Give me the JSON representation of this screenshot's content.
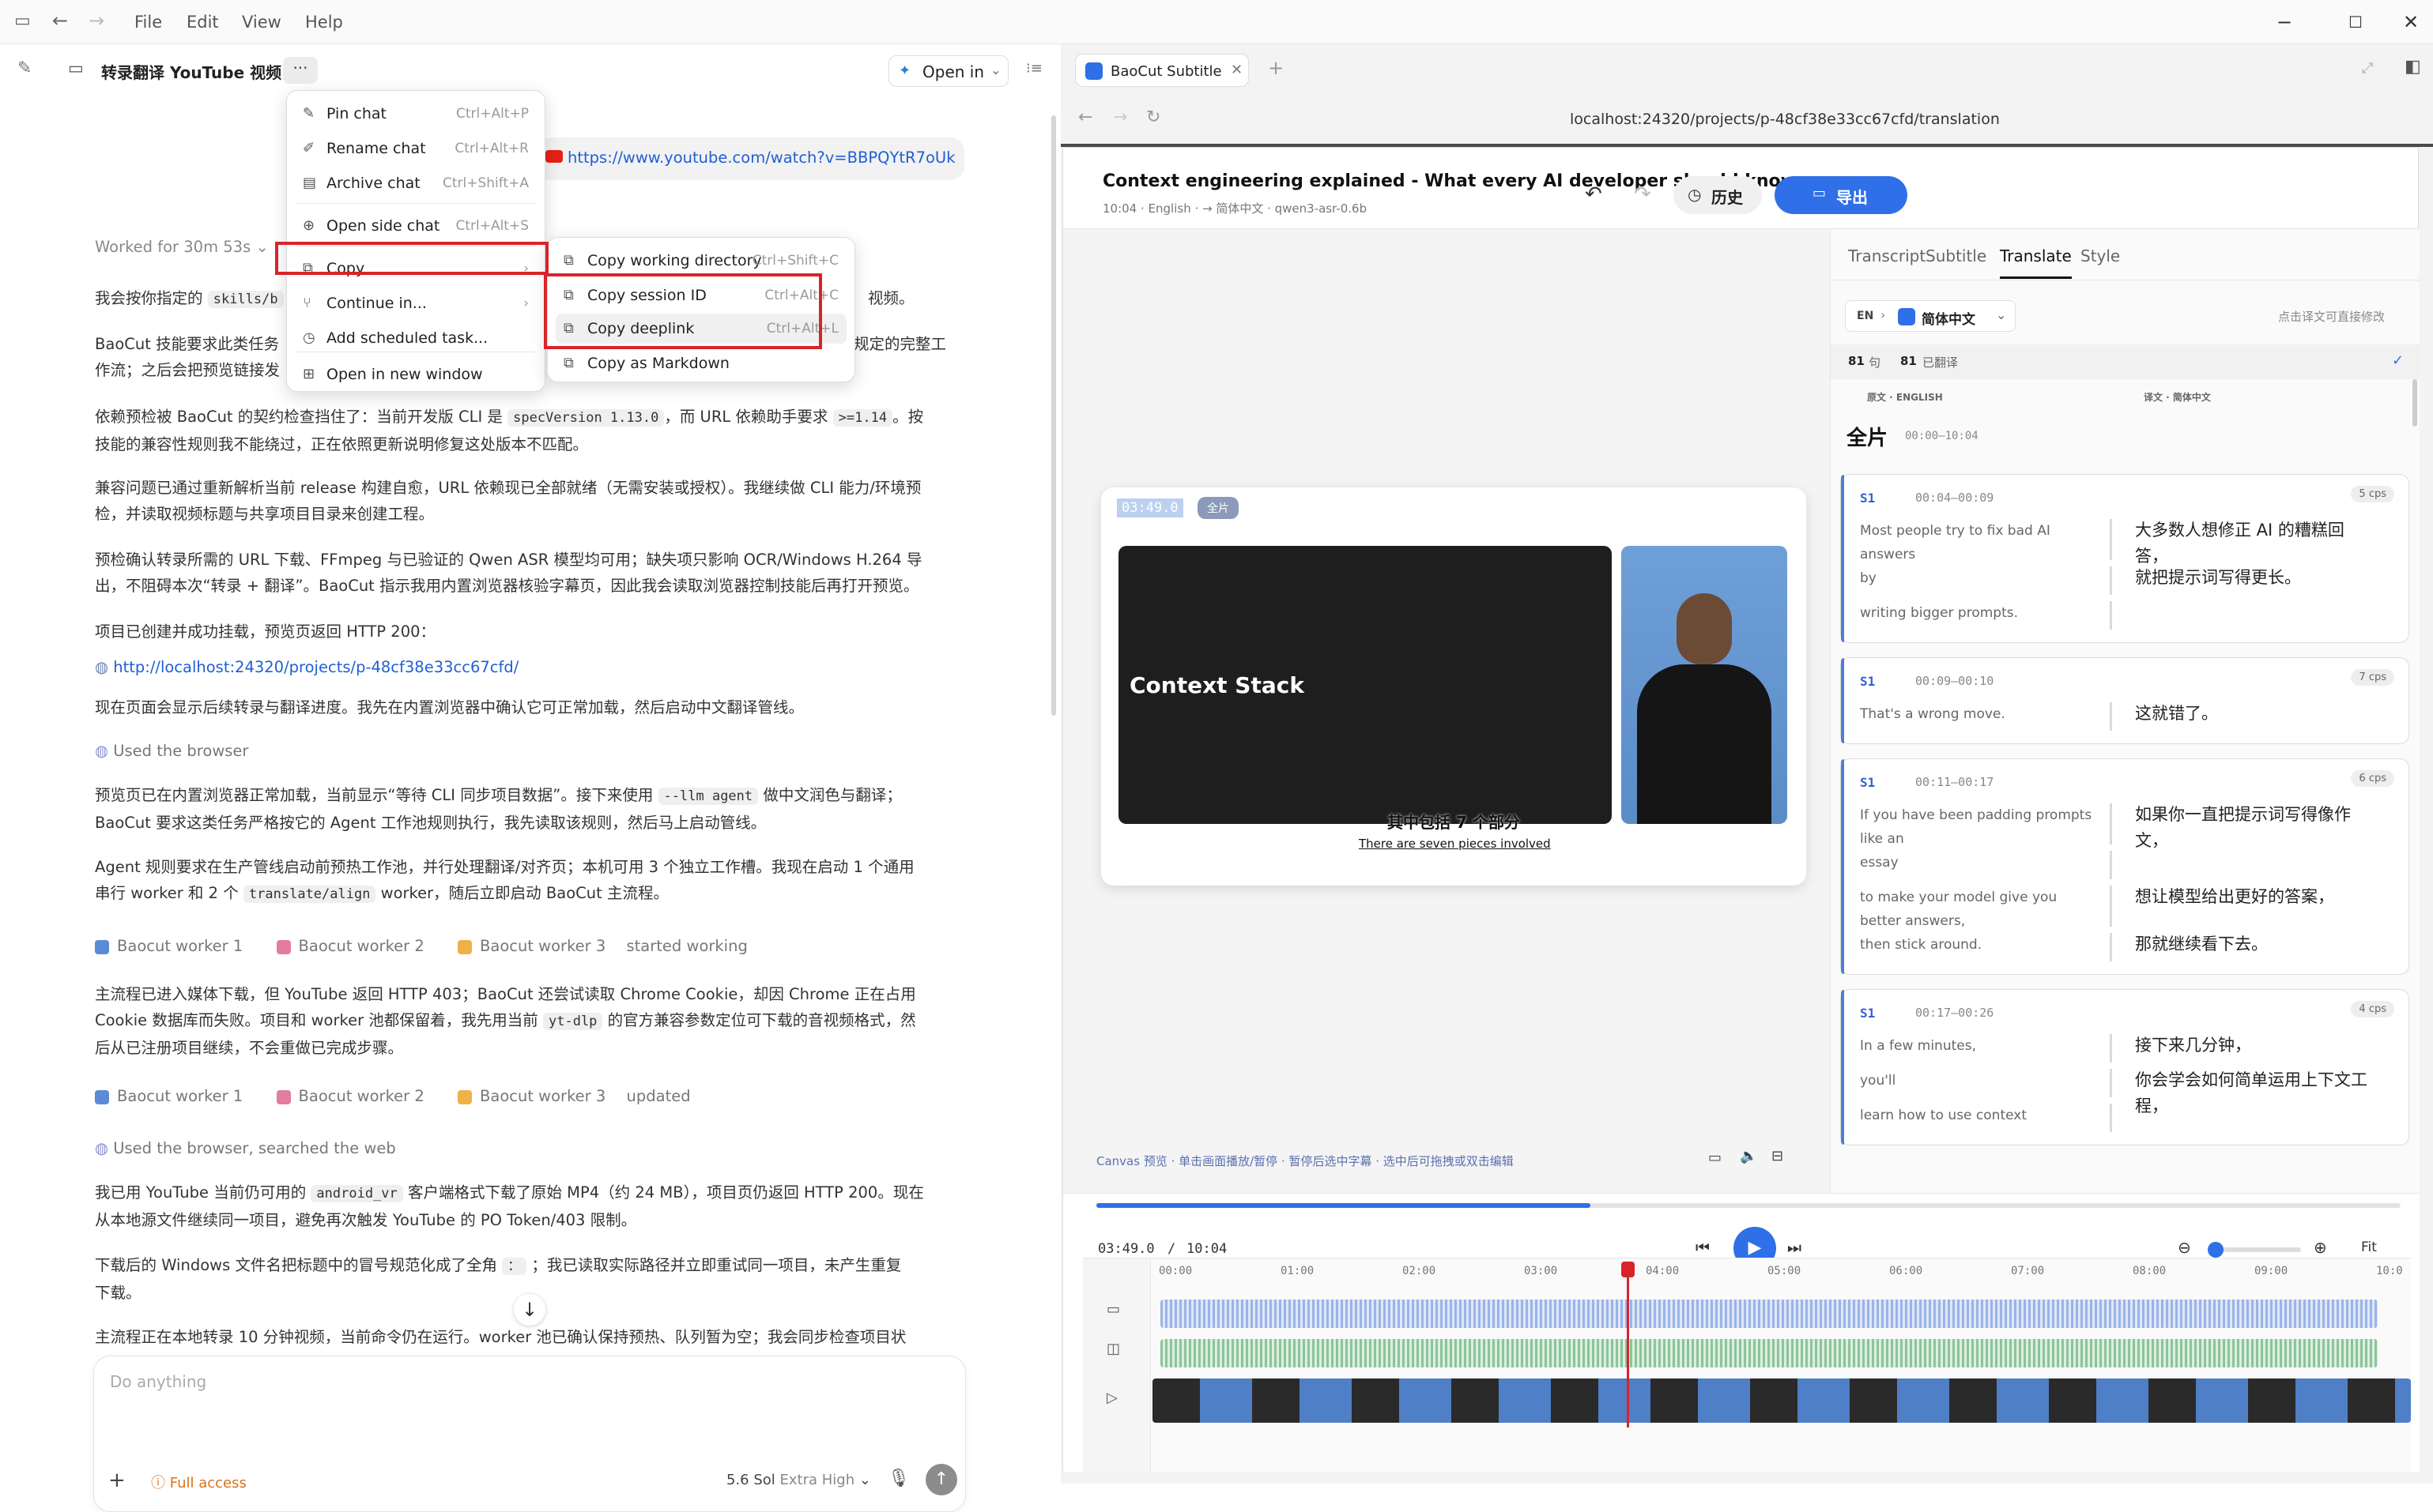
{
  "menubar": {
    "file": "File",
    "edit": "Edit",
    "view": "View",
    "help": "Help"
  },
  "chat": {
    "title": "转录翻译 YouTube 视频",
    "open_in": "Open in",
    "link": "https://www.youtube.com/watch?v=BBPQYtR7oUk",
    "worked": "Worked for 30m 53s",
    "p1a": "我会按你指定的",
    "p1code": "skills/b",
    "p1b": "视频。",
    "p2a": "BaoCut 技能要求此类任务",
    "p2b": "规定的完整工",
    "p2c": "作流；之后会把预览链接发",
    "p3a": "依赖预检被 BaoCut 的契约检查挡住了：当前开发版 CLI 是",
    "p3code1": "specVersion 1.13.0",
    "p3b": "，而 URL 依赖助手要求",
    "p3code2": ">=1.14",
    "p3c": "。按",
    "p3d": "技能的兼容性规则我不能绕过，正在依照更新说明修复这处版本不匹配。",
    "p4a": "兼容问题已通过重新解析当前 release 构建自愈，URL 依赖现已全部就绪（无需安装或授权）。我继续做 CLI 能力/环境预",
    "p4b": "检，并读取视频标题与共享项目目录来创建工程。",
    "p5a": "预检确认转录所需的 URL 下载、FFmpeg 与已验证的 Qwen ASR 模型均可用；缺失项只影响 OCR/Windows H.264 导",
    "p5b": "出，不阻碍本次“转录 + 翻译”。BaoCut 指示我用内置浏览器核验字幕页，因此我会读取浏览器控制技能后再打开预览。",
    "p6": "项目已创建并成功挂载，预览页返回 HTTP 200：",
    "p6link": "http://localhost:24320/projects/p-48cf38e33cc67cfd/",
    "p7": "现在页面会显示后续转录与翻译进度。我先在内置浏览器中确认它可正常加载，然后启动中文翻译管线。",
    "used1": "Used the browser",
    "p8a": "预览页已在内置浏览器正常加载，当前显示“等待 CLI 同步项目数据”。接下来使用",
    "p8code": "--llm agent",
    "p8b": "做中文润色与翻译；",
    "p8c": "BaoCut 要求这类任务严格按它的 Agent 工作池规则执行，我先读取该规则，然后马上启动管线。",
    "p9a": "Agent 规则要求在生产管线启动前预热工作池，并行处理翻译/对齐页；本机可用 3 个独立工作槽。我现在启动 1 个通用",
    "p9b": "串行 worker 和 2 个",
    "p9code": "translate/align",
    "p9c": "worker，随后立即启动 BaoCut 主流程。",
    "w1": "Baocut worker 1",
    "w2": "Baocut worker 2",
    "w3": "Baocut worker 3",
    "started": "started working",
    "p10a": "主流程已进入媒体下载，但 YouTube 返回 HTTP 403；BaoCut 还尝试读取 Chrome Cookie，却因 Chrome 正在占用",
    "p10b": "Cookie 数据库而失败。项目和 worker 池都保留着，我先用当前",
    "p10code": "yt-dlp",
    "p10c": "的官方兼容参数定位可下载的音视频格式，然",
    "p10d": "后从已注册项目继续，不会重做已完成步骤。",
    "updated": "updated",
    "used2": "Used the browser, searched the web",
    "p11a": "我已用 YouTube 当前仍可用的",
    "p11code": "android_vr",
    "p11b": "客户端格式下载了原始 MP4（约 24 MB），项目页仍返回 HTTP 200。现在",
    "p11c": "从本地源文件继续同一项目，避免再次触发 YouTube 的 PO Token/403 限制。",
    "p12a": "下载后的 Windows 文件名把标题中的冒号规范化成了全角",
    "p12code": "：",
    "p12b": "；我已读取实际路径并立即重试同一项目，未产生重复",
    "p12c": "下载。",
    "p13": "主流程正在本地转录 10 分钟视频，当前命令仍在运行。worker 池已确认保持预热、队列暂为空；我会同步检查项目状",
    "composer_placeholder": "Do anything",
    "full_access": "Full access",
    "model": "5.6 Sol",
    "effort": "Extra High"
  },
  "menu": {
    "items": [
      {
        "icon": "✎",
        "label": "Pin chat",
        "shortcut": "Ctrl+Alt+P"
      },
      {
        "icon": "✐",
        "label": "Rename chat",
        "shortcut": "Ctrl+Alt+R"
      },
      {
        "icon": "▤",
        "label": "Archive chat",
        "shortcut": "Ctrl+Shift+A"
      },
      {
        "icon": "⊕",
        "label": "Open side chat",
        "shortcut": "Ctrl+Alt+S"
      },
      {
        "icon": "⧉",
        "label": "Copy",
        "shortcut": "›"
      },
      {
        "icon": "⑂",
        "label": "Continue in...",
        "shortcut": "›"
      },
      {
        "icon": "◷",
        "label": "Add scheduled task...",
        "shortcut": ""
      },
      {
        "icon": "⊞",
        "label": "Open in new window",
        "shortcut": ""
      }
    ],
    "sub": [
      {
        "label": "Copy working directory",
        "shortcut": "Ctrl+Shift+C"
      },
      {
        "label": "Copy session ID",
        "shortcut": "Ctrl+Alt+C"
      },
      {
        "label": "Copy deeplink",
        "shortcut": "Ctrl+Alt+L"
      },
      {
        "label": "Copy as Markdown",
        "shortcut": ""
      }
    ]
  },
  "browser": {
    "tab_title": "BaoCut Subtitle",
    "url": "localhost:24320/projects/p-48cf38e33cc67cfd/translation"
  },
  "app": {
    "title": "Context engineering explained - What every AI developer should know",
    "meta": "10:04 · English · → 简体中文 · qwen3-asr-0.6b",
    "history": "历史",
    "export": "导出",
    "tabs": [
      "Transcript",
      "Subtitle",
      "Translate",
      "Style"
    ],
    "lang_src": "EN",
    "lang_tgt": "简体中文",
    "hint": "点击译文可直接修改",
    "count_a": "81",
    "count_a_label": "句",
    "count_b": "81",
    "count_b_label": "已翻译",
    "col_src": "原文 · ENGLISH",
    "col_tgt": "译文 · 简体中文",
    "section": "全片",
    "section_time": "00:00–10:04",
    "segments": [
      {
        "sp": "S1",
        "time": "00:04–00:09",
        "cps": "5 cps",
        "rows": [
          {
            "en": "Most people try to fix bad AI answers",
            "zh": "大多数人想修正 AI 的糟糕回答，"
          },
          {
            "en": "by",
            "zh": "就把提示词写得更长。"
          },
          {
            "en": "writing bigger prompts.",
            "zh": ""
          }
        ]
      },
      {
        "sp": "S1",
        "time": "00:09–00:10",
        "cps": "7 cps",
        "rows": [
          {
            "en": "That's a wrong move.",
            "zh": "这就错了。"
          }
        ]
      },
      {
        "sp": "S1",
        "time": "00:11–00:17",
        "cps": "6 cps",
        "rows": [
          {
            "en": "If you have been padding prompts like an",
            "zh": "如果你一直把提示词写得像作文，"
          },
          {
            "en": "essay",
            "zh": ""
          },
          {
            "en": "to make your model give you better answers,",
            "zh": "想让模型给出更好的答案，"
          },
          {
            "en": "then stick around.",
            "zh": "那就继续看下去。"
          }
        ]
      },
      {
        "sp": "S1",
        "time": "00:17–00:26",
        "cps": "4 cps",
        "rows": [
          {
            "en": "In a few minutes,",
            "zh": "接下来几分钟，"
          },
          {
            "en": "you'll",
            "zh": "你会学会如何简单运用上下文工程，"
          },
          {
            "en": "learn how to use context",
            "zh": ""
          }
        ]
      }
    ],
    "frame_time": "03:49.0",
    "frame_badge": "全片",
    "slide_text": "Context Stack",
    "sub_zh": "其中包括 7 个部分",
    "sub_en": "There are seven pieces involved",
    "canvas_hint": "Canvas 预览 · 单击画面播放/暂停 · 暂停后选中字幕 · 选中后可拖拽或双击编辑",
    "time_current": "03:49.0",
    "time_total": "10:04",
    "fit": "Fit",
    "playback_progress": 0.379
  },
  "timeline": {
    "ticks": [
      "00:00",
      "01:00",
      "02:00",
      "03:00",
      "04:00",
      "05:00",
      "06:00",
      "07:00",
      "08:00",
      "09:00",
      "10:0"
    ]
  },
  "colors": {
    "accent": "#2f6fe8",
    "red": "#d9232a",
    "speaker": "#335fd6"
  }
}
